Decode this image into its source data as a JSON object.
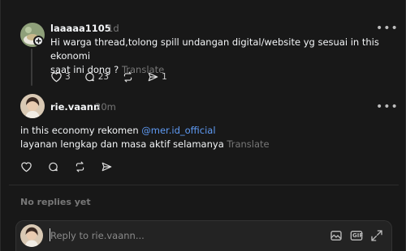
{
  "post": {
    "username": "laaaaa1105",
    "time": "1d",
    "more_label": "•••",
    "text_line1": "Hi warga thread,tolong spill undangan digital/website yg sesuai in this ekonomi",
    "text_line2": "saat ini dong ?",
    "translate": "Translate",
    "like_count": "3",
    "comment_count": "23",
    "share_count": "1",
    "icons": [
      "heart-icon",
      "comment-icon",
      "repost-icon",
      "send-icon",
      "follow-plus-icon"
    ]
  },
  "reply": {
    "username": "rie.vaann",
    "time": "20m",
    "more_label": "•••",
    "text_line1_prefix": "in this economy rekomen ",
    "mention": "@mer.id_official",
    "text_line2": "layanan lengkap dan masa aktif selamanya",
    "translate": "Translate",
    "icons": [
      "heart-icon",
      "comment-icon",
      "repost-icon",
      "send-icon"
    ]
  },
  "no_replies_label": "No replies yet",
  "composer": {
    "placeholder": "Reply to rie.vaann...",
    "tools": [
      "image-icon",
      "gif-icon",
      "expand-icon"
    ],
    "gif_label": "GIF"
  },
  "colors": {
    "background": "#181818",
    "text": "#f3f5f7",
    "muted": "#777777",
    "mention": "#5f9bf5"
  }
}
